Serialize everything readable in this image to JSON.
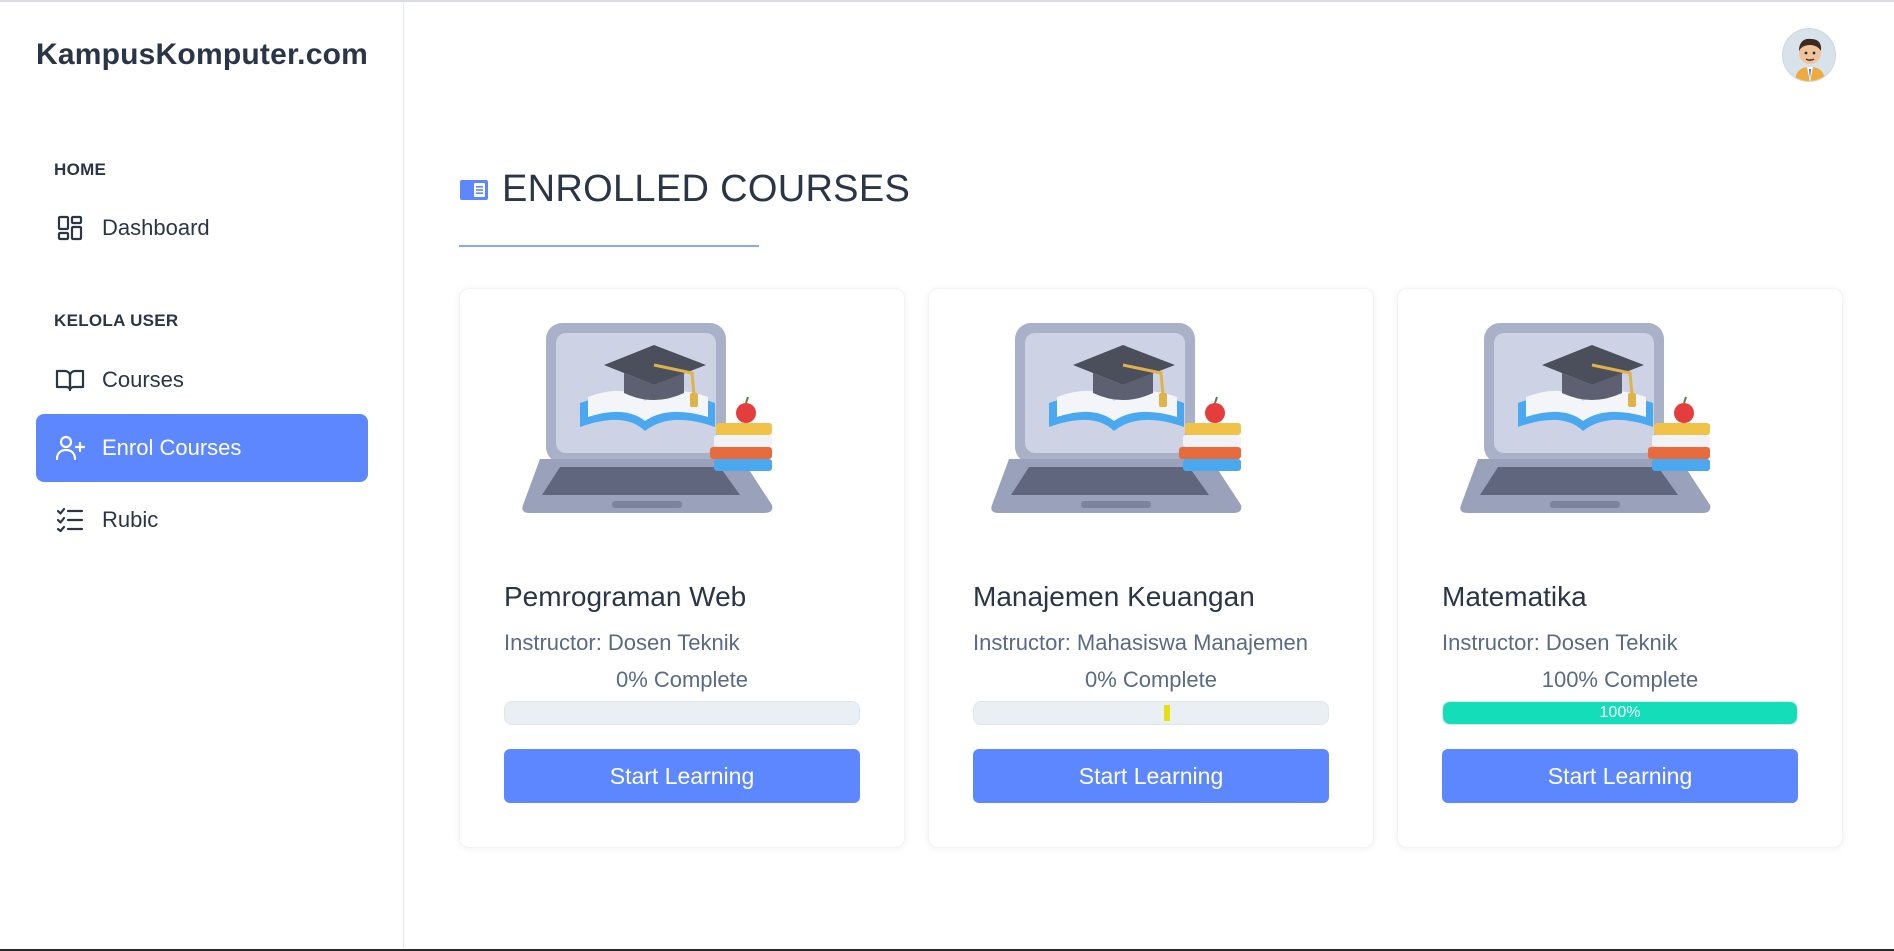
{
  "brand": "KampusKomputer.com",
  "sidebar": {
    "sections": [
      {
        "title": "HOME"
      },
      {
        "title": "KELOLA USER"
      }
    ],
    "items": [
      {
        "label": "Dashboard",
        "icon": "dashboard-icon"
      },
      {
        "label": "Courses",
        "icon": "book-open-icon"
      },
      {
        "label": "Enrol Courses",
        "icon": "user-plus-icon",
        "active": true
      },
      {
        "label": "Rubic",
        "icon": "checklist-icon"
      }
    ]
  },
  "header": {
    "title": "ENROLLED COURSES",
    "icon": "book-icon"
  },
  "colors": {
    "accent": "#5d87ff",
    "success": "#13deb9",
    "text": "#2a3547",
    "muted": "#5a6a85",
    "warning_tick": "#e5df14"
  },
  "courses": [
    {
      "title": "Pemrograman Web",
      "instructor": "Instructor: Dosen Teknik",
      "complete_text": "0% Complete",
      "progress": 0,
      "bar_label": "",
      "button": "Start Learning"
    },
    {
      "title": "Manajemen Keuangan",
      "instructor": "Instructor: Mahasiswa Manajemen",
      "complete_text": "0% Complete",
      "progress": 0,
      "bar_label": "",
      "button": "Start Learning"
    },
    {
      "title": "Matematika",
      "instructor": "Instructor: Dosen Teknik",
      "complete_text": "100% Complete",
      "progress": 100,
      "bar_label": "100%",
      "button": "Start Learning"
    }
  ]
}
